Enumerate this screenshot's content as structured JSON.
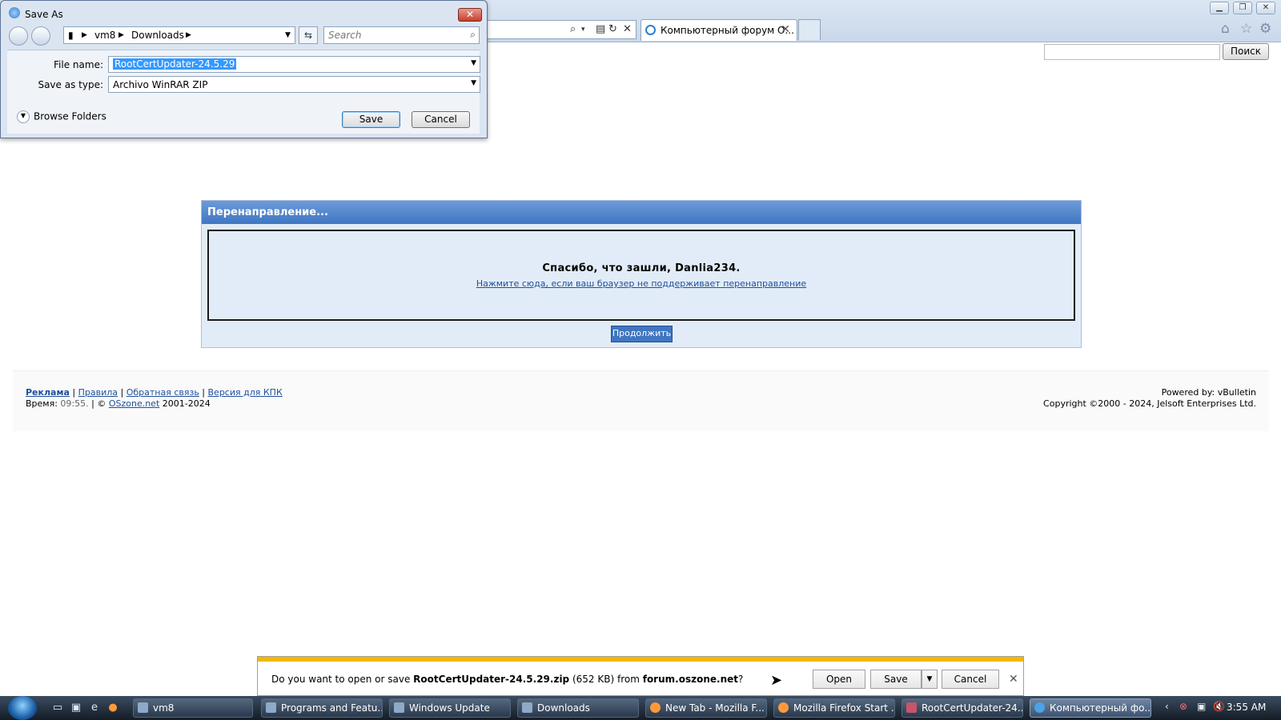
{
  "browser": {
    "tab_title": "Компьютерный форум О...",
    "search_button": "Поиск"
  },
  "redirect": {
    "header": "Перенаправление...",
    "thanks": "Спасибо, что зашли, Danlia234.",
    "link": "Нажмите сюда, если ваш браузер не поддерживает перенаправление",
    "continue": "Продолжить"
  },
  "footer": {
    "links": [
      "Реклама",
      "Правила",
      "Обратная связь",
      "Версия для КПК"
    ],
    "time_label": "Время:",
    "time": "09:55.",
    "site": "OSzone.net",
    "years": "2001-2024",
    "powered": "Powered by: vBulletin",
    "copyright": "Copyright ©2000 - 2024, Jelsoft Enterprises Ltd."
  },
  "save_dialog": {
    "title": "Save As",
    "path": [
      "vm8",
      "Downloads"
    ],
    "search_placeholder": "Search",
    "file_name_label": "File name:",
    "file_name": "RootCertUpdater-24.5.29",
    "save_type_label": "Save as type:",
    "save_type": "Archivo WinRAR ZIP",
    "browse_folders": "Browse Folders",
    "save": "Save",
    "cancel": "Cancel"
  },
  "notification": {
    "prefix": "Do you want to open or save ",
    "file": "RootCertUpdater-24.5.29.zip",
    "size": " (652 KB) from ",
    "site": "forum.oszone.net",
    "suffix": "?",
    "open": "Open",
    "save": "Save",
    "cancel": "Cancel"
  },
  "taskbar": {
    "tasks": [
      {
        "label": "vm8"
      },
      {
        "label": "Programs and Featu..."
      },
      {
        "label": "Windows Update"
      },
      {
        "label": "Downloads"
      },
      {
        "label": "New Tab - Mozilla F..."
      },
      {
        "label": "Mozilla Firefox Start ..."
      },
      {
        "label": "RootCertUpdater-24..."
      },
      {
        "label": "Компьютерный фо..."
      }
    ],
    "clock": "3:55 AM"
  }
}
